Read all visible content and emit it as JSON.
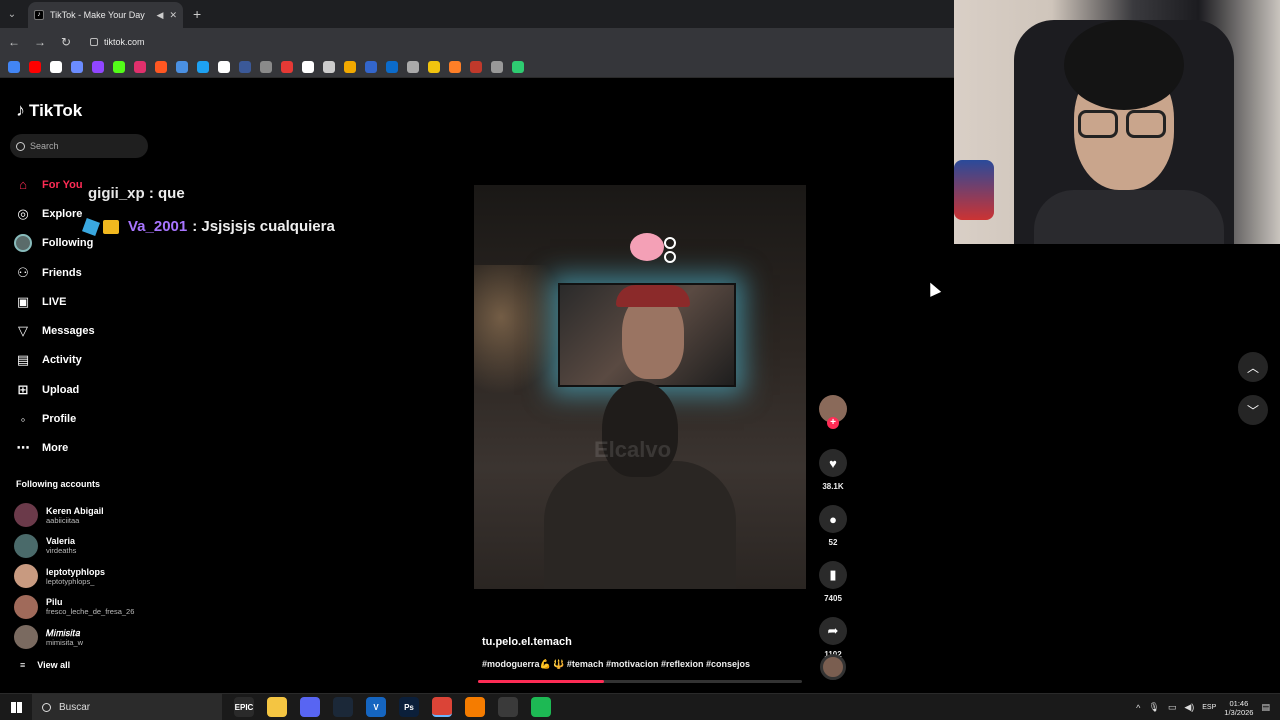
{
  "browser": {
    "tab_title": "TikTok - Make Your Day",
    "url": "tiktok.com",
    "bookmark_colors": [
      "#4285f4",
      "#ff0000",
      "#ffffff",
      "#6b8cff",
      "#9146ff",
      "#53fc18",
      "#e1306c",
      "#ff5722",
      "#4a90e2",
      "#1da1f2",
      "#ffffff",
      "#3b5998",
      "#8a8a8a",
      "#e53935",
      "#ffffff",
      "#cccccc",
      "#f2a900",
      "#3366cc",
      "#0b6bcb",
      "#aaaaaa",
      "#f1c40f",
      "#ff7f27",
      "#c0392b",
      "#999999",
      "#2ecc71"
    ]
  },
  "tiktok": {
    "logo_text": "TikTok",
    "search_placeholder": "Search",
    "menu": [
      {
        "label": "For You",
        "icon": "home-icon",
        "glyph": "⌂"
      },
      {
        "label": "Explore",
        "icon": "compass-icon",
        "glyph": "◎"
      },
      {
        "label": "Following",
        "icon": "avatar",
        "glyph": ""
      },
      {
        "label": "Friends",
        "icon": "friends-icon",
        "glyph": "⚇"
      },
      {
        "label": "LIVE",
        "icon": "live-icon",
        "glyph": "▣"
      },
      {
        "label": "Messages",
        "icon": "send-icon",
        "glyph": "▽"
      },
      {
        "label": "Activity",
        "icon": "activity-icon",
        "glyph": "▤"
      },
      {
        "label": "Upload",
        "icon": "upload-icon",
        "glyph": "⊞"
      },
      {
        "label": "Profile",
        "icon": "profile-icon",
        "glyph": "◦"
      },
      {
        "label": "More",
        "icon": "more-icon",
        "glyph": "⋯"
      }
    ],
    "following_header": "Following accounts",
    "accounts": [
      {
        "name": "Keren Abigail",
        "handle": "aabiiciitaa",
        "color": "#6b3a4a"
      },
      {
        "name": "Valeria",
        "handle": "virdeaths",
        "color": "#4a6a6a"
      },
      {
        "name": "leptotyphlops",
        "handle": "leptotyphlops_",
        "color": "#c89a80"
      },
      {
        "name": "Pilu",
        "handle": "fresco_leche_de_fresa_26",
        "color": "#a06a5a"
      },
      {
        "name": "𝑀𝑖𝑚𝑖𝑠𝑖𝑡𝑎",
        "handle": "mimisita_w",
        "color": "#7a6a60"
      }
    ],
    "view_all": "View all",
    "video": {
      "watermark": "Elcalvo",
      "author": "tu.pelo.el.temach",
      "tags": "#modoguerra💪 🔱 #temach #motivacion #reflexion #consejos",
      "progress": 0.39
    },
    "actions": {
      "likes": "38.1K",
      "comments": "52",
      "saves": "7405",
      "shares": "1102"
    }
  },
  "chat": [
    {
      "user": "gigii_xp",
      "message": ": que"
    },
    {
      "user": "Va_2001",
      "message": ": Jsjsjsjs cualquiera"
    }
  ],
  "taskbar": {
    "search_placeholder": "Buscar",
    "apps": [
      {
        "name": "epic",
        "label": "EPIC",
        "color": "#2a2a2a"
      },
      {
        "name": "files",
        "label": "",
        "color": "#f4c542"
      },
      {
        "name": "discord",
        "label": "",
        "color": "#5865f2"
      },
      {
        "name": "steam",
        "label": "",
        "color": "#1b2838"
      },
      {
        "name": "v-app",
        "label": "V",
        "color": "#1565c0"
      },
      {
        "name": "photoshop",
        "label": "Ps",
        "color": "#0b1f3a"
      },
      {
        "name": "chrome",
        "label": "",
        "color": "#db4437"
      },
      {
        "name": "fl-studio",
        "label": "",
        "color": "#f57c00"
      },
      {
        "name": "obs",
        "label": "",
        "color": "#3a3a3a"
      },
      {
        "name": "spotify",
        "label": "",
        "color": "#1db954"
      }
    ],
    "lang": "ESP",
    "time": "01:46",
    "date": "1/3/2026"
  }
}
